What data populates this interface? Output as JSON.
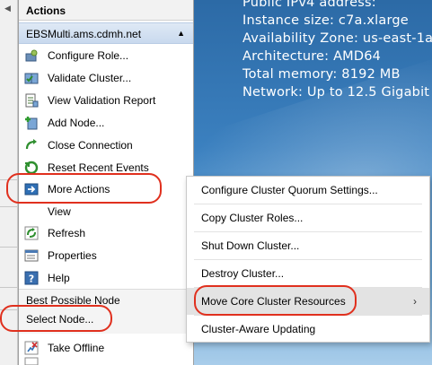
{
  "bginfo": {
    "lines": [
      "Public IPv4 address:",
      "Instance size: c7a.xlarge",
      "Availability Zone: us-east-1a",
      "Architecture: AMD64",
      "Total memory: 8192 MB",
      "Network: Up to 12.5 Gigabit"
    ]
  },
  "actions": {
    "title": "Actions",
    "section": "EBSMulti.ams.cdmh.net",
    "items": [
      {
        "label": "Configure Role...",
        "icon": "configure-role-icon"
      },
      {
        "label": "Validate Cluster...",
        "icon": "validate-cluster-icon"
      },
      {
        "label": "View Validation Report",
        "icon": "validation-report-icon"
      },
      {
        "label": "Add Node...",
        "icon": "add-node-icon"
      },
      {
        "label": "Close Connection",
        "icon": "close-connection-icon"
      },
      {
        "label": "Reset Recent Events",
        "icon": "reset-events-icon"
      },
      {
        "label": "More Actions",
        "icon": "more-actions-icon"
      },
      {
        "label": "View",
        "icon": ""
      },
      {
        "label": "Refresh",
        "icon": "refresh-icon"
      },
      {
        "label": "Properties",
        "icon": "properties-icon"
      },
      {
        "label": "Help",
        "icon": "help-icon"
      }
    ],
    "lower": {
      "best_possible_node": "Best Possible Node",
      "select_node": "Select Node...",
      "take_offline": "Take Offline"
    }
  },
  "submenu": {
    "items": [
      {
        "label": "Configure Cluster Quorum Settings..."
      },
      {
        "label": "Copy Cluster Roles..."
      },
      {
        "label": "Shut Down Cluster..."
      },
      {
        "label": "Destroy Cluster..."
      },
      {
        "label": "Move Core Cluster Resources",
        "chevron": "›"
      },
      {
        "label": "Cluster-Aware Updating"
      }
    ]
  },
  "colors": {
    "highlight_oval": "#e0301e",
    "section_header": "#c9d9ee",
    "wallpaper": "#3b80bf"
  }
}
